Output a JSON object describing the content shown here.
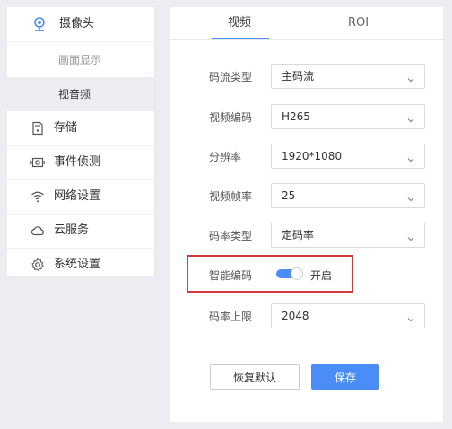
{
  "sidebar": {
    "items": [
      {
        "label": "摄像头",
        "icon": "camera-icon"
      },
      {
        "label": "画面显示"
      },
      {
        "label": "视音频"
      },
      {
        "label": "存储",
        "icon": "sd-card-icon"
      },
      {
        "label": "事件侦测",
        "icon": "motion-camera-icon"
      },
      {
        "label": "网络设置",
        "icon": "wifi-icon"
      },
      {
        "label": "云服务",
        "icon": "cloud-icon"
      },
      {
        "label": "系统设置",
        "icon": "gear-icon"
      }
    ]
  },
  "tabs": [
    {
      "label": "视频"
    },
    {
      "label": "ROI"
    }
  ],
  "form": {
    "stream_type": {
      "label": "码流类型",
      "value": "主码流"
    },
    "video_codec": {
      "label": "视频编码",
      "value": "H265"
    },
    "resolution": {
      "label": "分辨率",
      "value": "1920*1080"
    },
    "frame_rate": {
      "label": "视频帧率",
      "value": "25"
    },
    "bitrate_type": {
      "label": "码率类型",
      "value": "定码率"
    },
    "smart_encoding": {
      "label": "智能编码",
      "state_label": "开启",
      "enabled": true
    },
    "bitrate_limit": {
      "label": "码率上限",
      "value": "2048"
    }
  },
  "buttons": {
    "reset": "恢复默认",
    "save": "保存"
  },
  "colors": {
    "accent": "#4a8df7",
    "highlight": "#d7383b",
    "selected_bg": "#ebedf1"
  }
}
